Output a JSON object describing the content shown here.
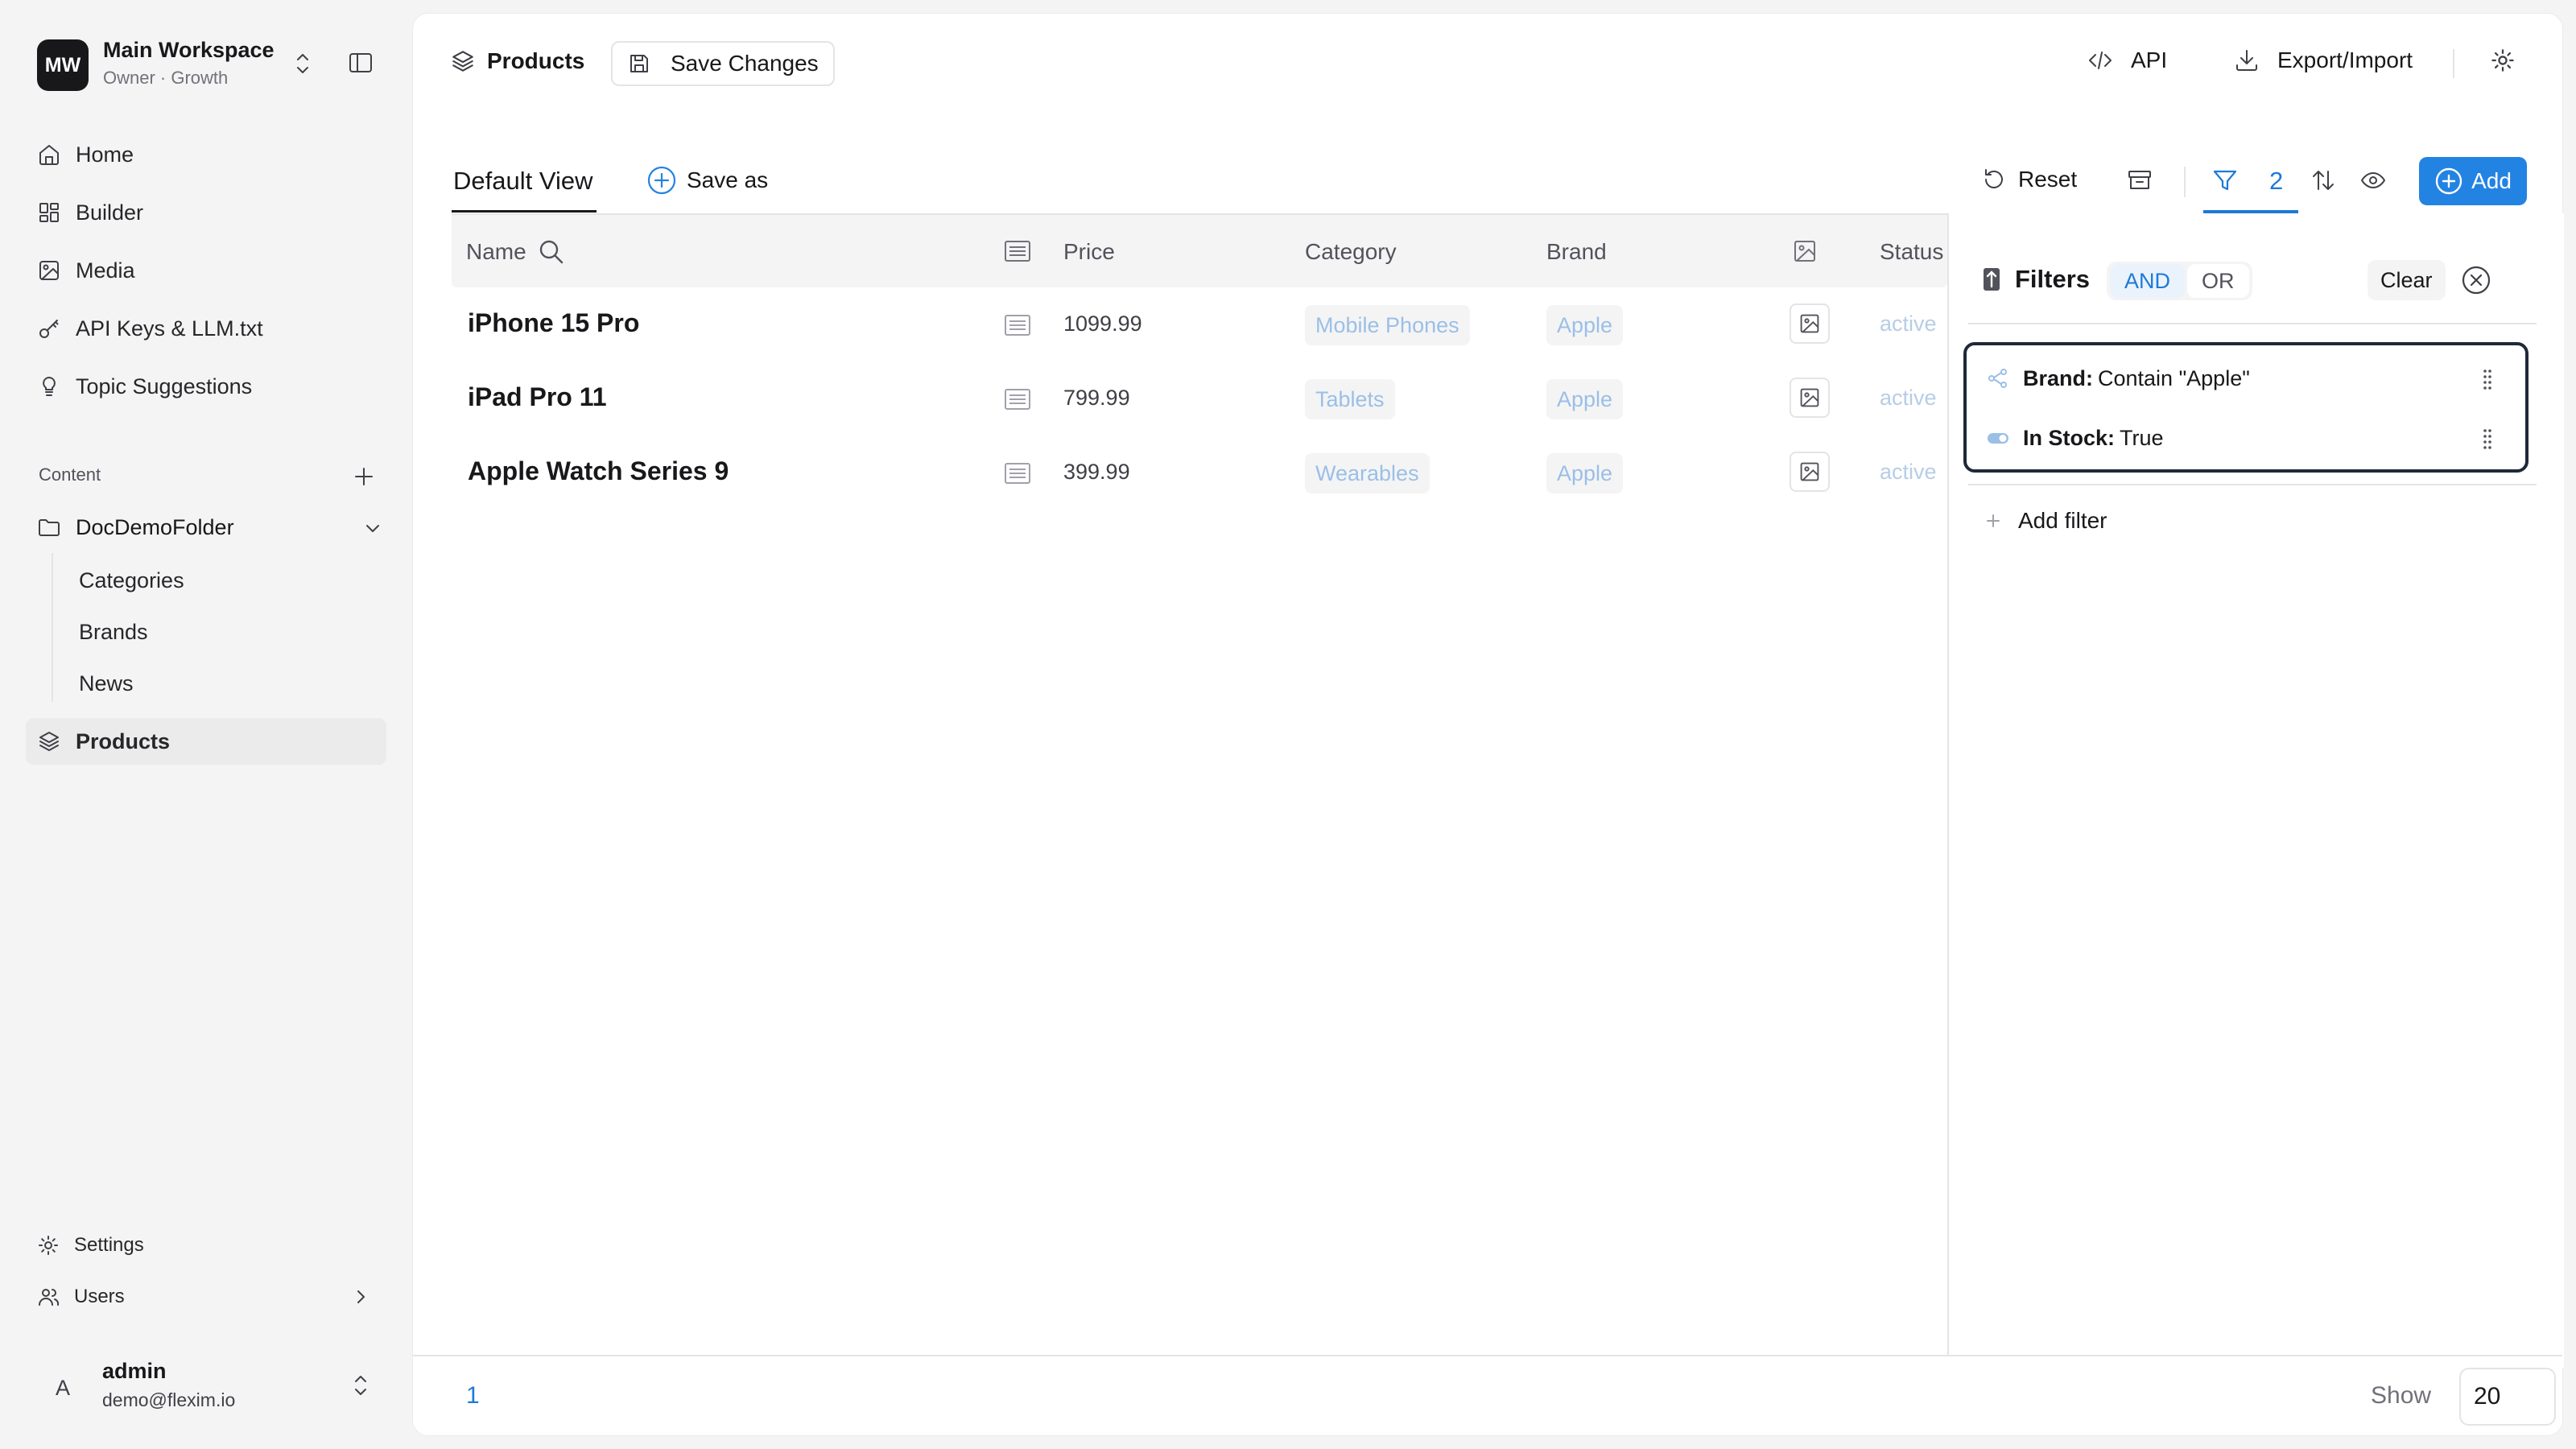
{
  "workspace": {
    "initials": "MW",
    "name": "Main Workspace",
    "subtitle": "Owner · Growth"
  },
  "nav": [
    {
      "label": "Home",
      "icon": "home-icon"
    },
    {
      "label": "Builder",
      "icon": "grid-icon"
    },
    {
      "label": "Media",
      "icon": "image-icon"
    },
    {
      "label": "API Keys & LLM.txt",
      "icon": "key-icon"
    },
    {
      "label": "Topic Suggestions",
      "icon": "lightbulb-icon"
    }
  ],
  "content_section": {
    "label": "Content",
    "folder": "DocDemoFolder",
    "children": [
      "Categories",
      "Brands",
      "News"
    ],
    "active": "Products"
  },
  "bottom_nav": {
    "settings": "Settings",
    "users": "Users"
  },
  "user": {
    "initial": "A",
    "name": "admin",
    "email": "demo@flexim.io"
  },
  "header": {
    "breadcrumb": "Products",
    "save_changes": "Save Changes",
    "api": "API",
    "export_import": "Export/Import"
  },
  "toolbar": {
    "view_tab": "Default View",
    "save_as": "Save as",
    "reset": "Reset",
    "filter_count": "2",
    "add": "Add"
  },
  "table": {
    "columns": [
      "Name",
      "Price",
      "Category",
      "Brand",
      "Status"
    ],
    "rows": [
      {
        "name": "iPhone 15 Pro",
        "price": "1099.99",
        "category": "Mobile Phones",
        "brand": "Apple",
        "status": "active"
      },
      {
        "name": "iPad Pro 11",
        "price": "799.99",
        "category": "Tablets",
        "brand": "Apple",
        "status": "active"
      },
      {
        "name": "Apple Watch Series 9",
        "price": "399.99",
        "category": "Wearables",
        "brand": "Apple",
        "status": "active"
      }
    ]
  },
  "filters": {
    "title": "Filters",
    "and_label": "AND",
    "or_label": "OR",
    "clear": "Clear",
    "items": [
      {
        "field": "Brand:",
        "condition": "Contain \"Apple\""
      },
      {
        "field": "In Stock:",
        "condition": "True"
      }
    ],
    "add_filter": "Add filter"
  },
  "footer": {
    "page": "1",
    "show_label": "Show",
    "page_size": "20"
  },
  "colors": {
    "accent": "#2383e2",
    "accent_text": "#1d7ad6",
    "chip_text": "#9bbfe6"
  }
}
